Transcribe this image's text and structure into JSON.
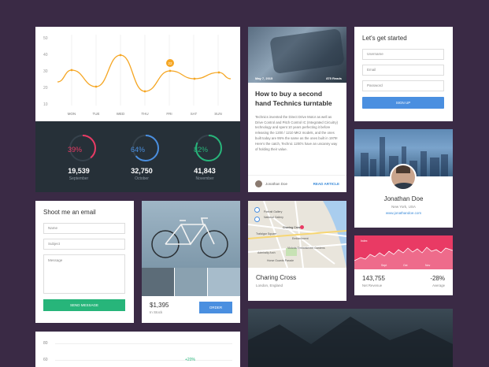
{
  "colors": {
    "orange": "#f5a623",
    "red": "#e93a64",
    "blue": "#4a8fe0",
    "green": "#27b57a"
  },
  "line_chart": {
    "y_ticks": [
      "50",
      "40",
      "30",
      "20",
      "10"
    ],
    "days": [
      "MON",
      "TUE",
      "WED",
      "THU",
      "FRI",
      "SAT",
      "SUN"
    ],
    "tooltip_value": "22"
  },
  "stats": [
    {
      "percent": "39%",
      "percent_value": 39,
      "value": "19,539",
      "label": "September",
      "color": "#e93a64"
    },
    {
      "percent": "64%",
      "percent_value": 64,
      "value": "32,750",
      "label": "October",
      "color": "#4a8fe0"
    },
    {
      "percent": "82%",
      "percent_value": 82,
      "value": "41,843",
      "label": "November",
      "color": "#27b57a"
    }
  ],
  "article": {
    "date": "May 7, 2015",
    "reads": "875 Reads",
    "title": "How to buy a second hand Technics turntable",
    "body": "Technics invented the Direct Drive Motor as well as Drive Control and Pitch Control IC (Integrated Circuitry) technology and spent 10 years perfecting it before releasing the 1200 / 1210 MK2 models, and the ones built today are 95% the same as the ones built in 1979! Here's the catch, Technic 1200's have an uncanny way of holding their value.",
    "author": "Jonathan Doe",
    "read_label": "READ ARTICLE"
  },
  "signup": {
    "title": "Let's get started",
    "username_placeholder": "Username",
    "email_placeholder": "Email",
    "password_placeholder": "Password",
    "button": "SIGN UP"
  },
  "profile": {
    "name": "Jonathan Doe",
    "location": "New York, USA",
    "link": "www.jonathandoe.com"
  },
  "email_form": {
    "title": "Shoot me an email",
    "name_placeholder": "Name",
    "subject_placeholder": "Subject",
    "message_placeholder": "Message",
    "button": "SEND MESSAGE"
  },
  "product": {
    "price": "$1,395",
    "stock": "In Stock",
    "button": "ORDER"
  },
  "map": {
    "place": "Charing Cross",
    "sub": "London, England",
    "labels": [
      "Portrait Gallery",
      "National Gallery",
      "Charing Cross",
      "Embankment",
      "Trafalgar Square",
      "Victoria Embankment Gardens",
      "Admiralty Arch",
      "Horse Guards Parade"
    ]
  },
  "revenue": {
    "labels": [
      "Index",
      "Sept",
      "Oct",
      "Nov"
    ],
    "value": "143,755",
    "value_label": "Net Revenue",
    "change": "-28%",
    "change_label": "Average"
  },
  "bottom_chart": {
    "y_ticks": [
      "80",
      "60"
    ],
    "badge": "+20%"
  }
}
